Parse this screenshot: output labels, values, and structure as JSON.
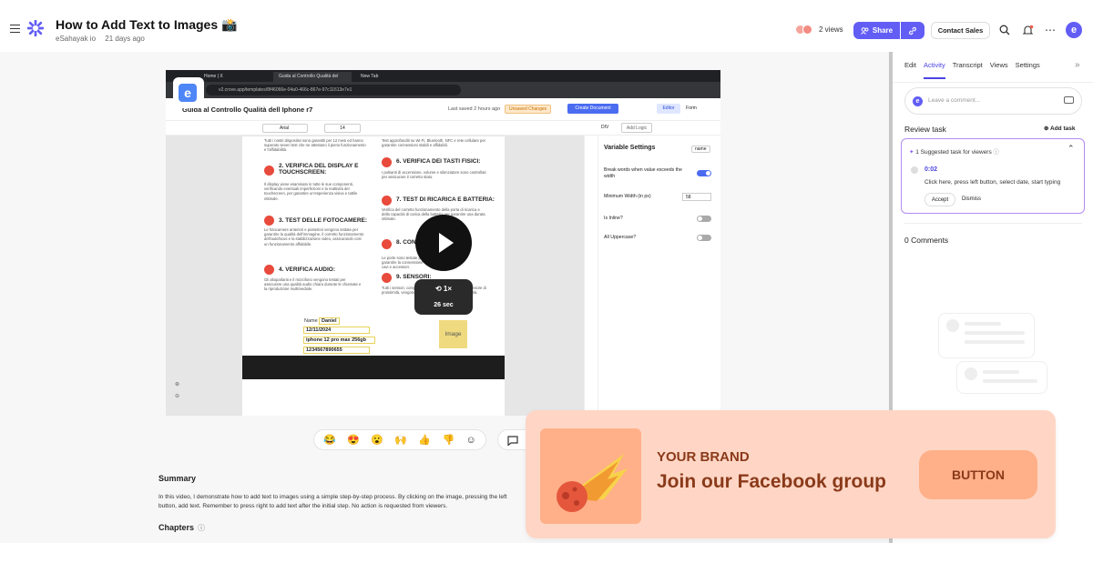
{
  "header": {
    "title": "How to Add Text to Images 📸",
    "author": "eSahayak io",
    "date": "21 days ago",
    "views": "2 views",
    "share_label": "Share",
    "contact_label": "Contact Sales",
    "avatar_letter": "e",
    "accent": "#625df5"
  },
  "video": {
    "tabs": [
      "Home | X",
      "Guida al Controllo Qualità del",
      "New Tab"
    ],
    "url": "v2.crove.app/templates/8f46066e-04a0-466c-867e-97c11613e7e1",
    "doc_title": "Guida al Controllo Qualità dell Iphone r7",
    "last_saved": "Last saved 2 hours ago",
    "unsaved": "Unsaved Changes",
    "create_document": "Create Document",
    "editor_label": "Editor",
    "form_label": "Form",
    "font": "Arial",
    "font_size": "14",
    "div_label": "DIV",
    "add_logic": "Add Logic",
    "sections_left": [
      {
        "title": "2. VERIFICA DEL DISPLAY E TOUCHSCREEN:",
        "body": "Il display viene esaminato in tutte le sue componenti, verificando eventuali imperfezioni e la reattività del touchscreen, per garantire un'esperienza visiva e tattile ottimale."
      },
      {
        "title": "3. TEST DELLE FOTOCAMERE:",
        "body": "Le fotocamere anteriori e posteriori vengono testate per garantire la qualità dell'immagine, il corretto funzionamento dell'autofocus e la stabilizzazione video, assicurando così un funzionamento affidabile."
      },
      {
        "title": "4. VERIFICA AUDIO:",
        "body": "Gli altoparlanti e il microfono vengono testati per assicurare una qualità audio chiara durante le chiamate e la riproduzione multimediale."
      }
    ],
    "sections_right": [
      {
        "title": "6. VERIFICA DEI TASTI FISICI:",
        "body": "I pulsanti di accensione, volume e silenziatore sono controllati per assicurare il corretto stato."
      },
      {
        "title": "7. TEST DI RICARICA E BATTERIA:",
        "body": "Verifica del corretto funzionamento della porta di ricarica e della capacità di carica della batteria per garantire una durata ottimale."
      },
      {
        "title": "8. CON",
        "body": "Le porte sono testate per garantire la connessione con cavi e accessori."
      },
      {
        "title": "9. SENSORI:",
        "body": "Tutti i sensori, compresi quelli di prossimità, GPS e sensore di prossimità, vengono testati per verificarne la funzionalità."
      }
    ],
    "intro_body": "Tutti i nostri dispositivi sono garantiti per 12 mesi ed hanno superato severi test che ne attestano il pieno funzionamento e l'affidabilità.",
    "intro_right": "Test approfonditi su Wi-Fi, Bluetooth, NFC e rete cellulare per garantire connessioni stabili e affidabili.",
    "name_label": "Name",
    "name_value": "Daniel",
    "field_date": "12/11/2024",
    "field_model": "iphone 12 pro max 256gb",
    "field_serial": "1234567890655",
    "image_label": "Image",
    "panel_title": "Variable Settings",
    "panel_name_chip": "name",
    "panel_break": "Break words when value exceeds the width",
    "panel_minwidth": "Minimum Width (in px)",
    "panel_minwidth_value": "58",
    "panel_inline": "Is Inline?",
    "panel_upper": "All Uppercase?",
    "speed": "1×",
    "duration": "26 sec",
    "logo_letter": "e"
  },
  "reactions": [
    "😂",
    "😍",
    "😮",
    "🙌",
    "👍",
    "👎",
    "☺"
  ],
  "summary": {
    "heading": "Summary",
    "text": "In this video, I demonstrate how to add text to images using a simple step-by-step process. By clicking on the image, pressing the left button, add text. Remember to press right to add text after the initial step. No action is requested from viewers.",
    "chapters_heading": "Chapters"
  },
  "sidebar": {
    "tabs": [
      "Edit",
      "Activity",
      "Transcript",
      "Views",
      "Settings"
    ],
    "active_tab": "Activity",
    "comment_placeholder": "Leave a comment...",
    "review_task": "Review task",
    "add_task": "Add task",
    "suggested": "1 Suggested task for viewers",
    "time": "0:02",
    "task_text": "Click here, press left button, select date, start typing",
    "accept": "Accept",
    "dismiss": "Dismiss",
    "comments_count": "0 Comments"
  },
  "ad": {
    "brand": "YOUR BRAND",
    "headline": "Join our Facebook group",
    "button": "BUTTON",
    "bg": "#ffd6c5",
    "text_color": "#8a3a1a"
  }
}
